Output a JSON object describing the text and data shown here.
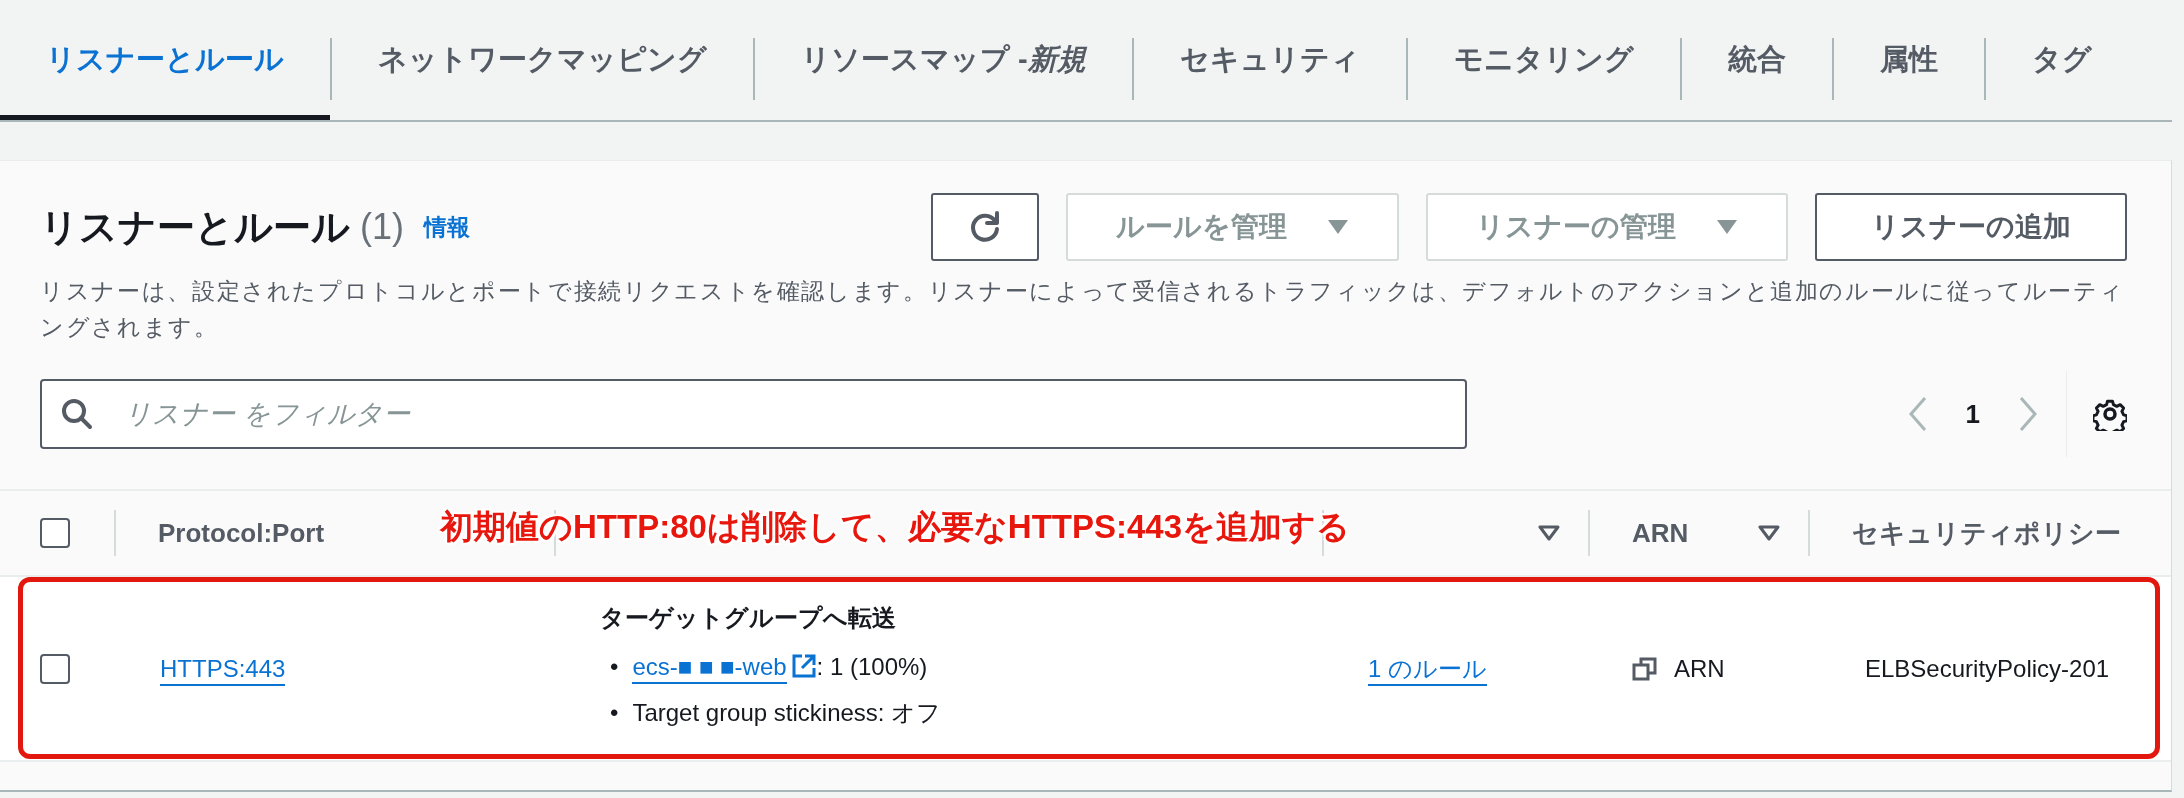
{
  "tabs": [
    {
      "label": "リスナーとルール",
      "selected": true
    },
    {
      "label": "ネットワークマッピング",
      "selected": false
    },
    {
      "label": "リソースマップ -",
      "tag": "新規",
      "selected": false
    },
    {
      "label": "セキュリティ",
      "selected": false
    },
    {
      "label": "モニタリング",
      "selected": false
    },
    {
      "label": "統合",
      "selected": false
    },
    {
      "label": "属性",
      "selected": false
    },
    {
      "label": "タグ",
      "selected": false
    }
  ],
  "panel": {
    "title": "リスナーとルール",
    "count": "(1)",
    "info_link": "情報",
    "buttons": [
      {
        "kind": "refresh",
        "disabled": false
      },
      {
        "kind": "dropdown",
        "label": "ルールを管理",
        "disabled": true
      },
      {
        "kind": "dropdown",
        "label": "リスナーの管理",
        "disabled": true
      },
      {
        "kind": "text",
        "label": "リスナーの追加",
        "disabled": false
      }
    ],
    "description": "リスナーは、設定されたプロトコルとポートで接続リクエストを確認します。リスナーによって受信されるトラフィックは、デフォルトのアクションと追加のルールに従ってルーティングされます。",
    "filter": {
      "placeholder": "リスナー をフィルター"
    },
    "pagination": {
      "pages": [
        {
          "label": "1",
          "selected": true
        }
      ]
    }
  },
  "table": {
    "select_all": {
      "checked": false
    },
    "columns": [
      {
        "label": "Protocol:Port",
        "sortable": false
      },
      {
        "sortable": false
      },
      {
        "sortable": true
      },
      {
        "label": "ARN",
        "sortable": true
      },
      {
        "label": "セキュリティポリシー"
      }
    ],
    "rows": [
      {
        "selected": false,
        "protocol_port": "HTTPS:443",
        "column_2": {
          "title": "ターゲットグループへ転送",
          "items": [
            {
              "kind": "link",
              "bullet": "•",
              "link": "ecs-■ ■ ■-web",
              "text": ": 1 (100%)"
            },
            {
              "kind": "text",
              "bullet": "•",
              "text": "Target group stickiness: オフ"
            }
          ]
        },
        "column_3": "1 のルール",
        "arn": "ARN",
        "security_policy": "ELBSecurityPolicy-201"
      }
    ]
  },
  "annotation": {
    "text": "初期値のHTTP:80は削除して、必要なHTTPS:443を追加する",
    "highlight_box": true
  }
}
